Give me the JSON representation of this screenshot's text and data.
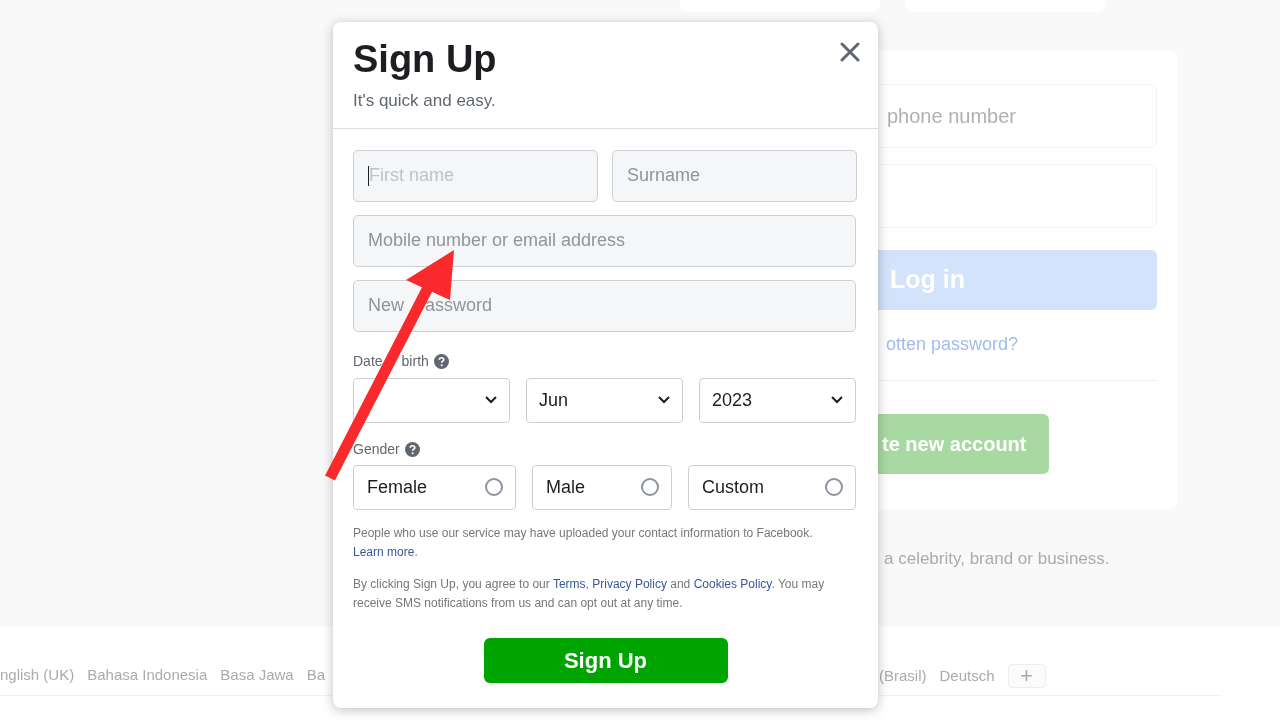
{
  "background": {
    "login_card": {
      "email_placeholder": "phone number",
      "login_button": "Log in",
      "forgot_link": "otten password?",
      "create_button": "te new account"
    },
    "page_note": "a celebrity, brand or business.",
    "languages_left": [
      "nglish (UK)",
      "Bahasa Indonesia",
      "Basa Jawa",
      "Ba"
    ],
    "languages_right": [
      "(Brasil)",
      "Deutsch"
    ],
    "more_languages_button": "+"
  },
  "dialog": {
    "title": "Sign Up",
    "subtitle": "It's quick and easy.",
    "name_fields": [
      {
        "placeholder": "First name",
        "focused": true
      },
      {
        "placeholder": "Surname",
        "focused": false
      }
    ],
    "contact_field": {
      "placeholder": "Mobile number or email address"
    },
    "password_field": {
      "placeholder_parts": [
        "New",
        "assword"
      ]
    },
    "dob_label_parts": [
      "Date",
      "birth"
    ],
    "dob_selects": [
      {
        "value": "Jun"
      },
      {
        "value": "2023"
      }
    ],
    "gender_label": "Gender",
    "gender_options": [
      {
        "label": "Female",
        "selected": false
      },
      {
        "label": "Male",
        "selected": false
      },
      {
        "label": "Custom",
        "selected": false
      }
    ],
    "notices": [
      [
        {
          "text": "People who use our service may have uploaded your contact information to Facebook. "
        },
        {
          "text": "Learn more",
          "link": true
        },
        {
          "text": "."
        }
      ],
      [
        {
          "text": "By clicking Sign Up, you agree to our "
        },
        {
          "text": "Terms",
          "link": true
        },
        {
          "text": ", "
        },
        {
          "text": "Privacy Policy",
          "link": true
        },
        {
          "text": " and "
        },
        {
          "text": "Cookies Policy",
          "link": true
        },
        {
          "text": ". You may receive SMS notifications from us and can opt out at any time."
        }
      ]
    ],
    "submit_button": "Sign Up"
  }
}
